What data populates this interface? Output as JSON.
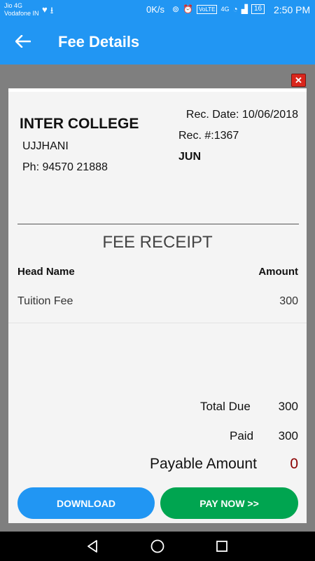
{
  "status_bar": {
    "carrier_line1": "Jio 4G",
    "carrier_line2": "Vodafone IN",
    "net_speed": "0K/s",
    "volte": "VoLTE",
    "network": "4G",
    "battery": "16",
    "time": "2:50 PM",
    "icons": [
      "heart-rate-icon",
      "download-icon",
      "hotspot-icon",
      "alarm-icon",
      "wifi-icon",
      "signal-icon",
      "battery-icon"
    ]
  },
  "app_bar": {
    "title": "Fee Details",
    "back_icon": "arrow-left-icon",
    "color": "#2196f3"
  },
  "dialog": {
    "close_icon": "close-icon",
    "college": {
      "name": "INTER COLLEGE",
      "city": "UJJHANI",
      "phone": "Ph: 94570 21888"
    },
    "receipt_meta": {
      "date": "Rec. Date: 10/06/2018",
      "number": "Rec. #:1367",
      "month": "JUN"
    },
    "receipt_title": "FEE RECEIPT",
    "table": {
      "headers": [
        "Head Name",
        "Amount"
      ],
      "rows": [
        {
          "name": "Tuition Fee",
          "amount": "300"
        }
      ]
    },
    "summary": {
      "total_due_label": "Total Due",
      "total_due_value": "300",
      "paid_label": "Paid",
      "paid_value": "300",
      "payable_label": "Payable Amount",
      "payable_value": "0"
    },
    "buttons": {
      "download": "DOWNLOAD",
      "pay_now": "PAY NOW >>"
    },
    "colors": {
      "download": "#2196f3",
      "pay_now": "#00a550",
      "payable": "#8b0000"
    }
  },
  "nav_bar": {
    "icons": [
      "nav-back-icon",
      "nav-home-icon",
      "nav-recent-icon"
    ]
  }
}
